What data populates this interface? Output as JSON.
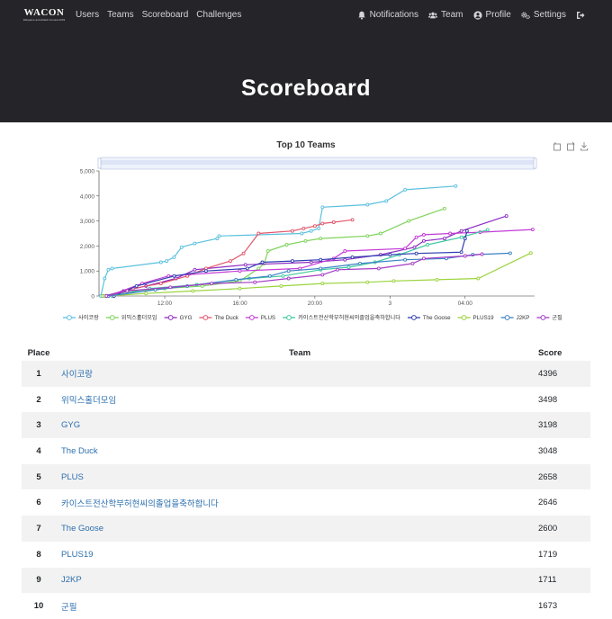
{
  "brand": {
    "name": "WACON",
    "tagline": "Wargame and Attack Contest 2023"
  },
  "nav": {
    "left": [
      "Users",
      "Teams",
      "Scoreboard",
      "Challenges"
    ],
    "right": [
      {
        "label": "Notifications",
        "icon": "bell-icon"
      },
      {
        "label": "Team",
        "icon": "users-icon"
      },
      {
        "label": "Profile",
        "icon": "user-circle-icon"
      },
      {
        "label": "Settings",
        "icon": "gears-icon"
      },
      {
        "label": "",
        "icon": "logout-icon"
      }
    ]
  },
  "page": {
    "title": "Scoreboard"
  },
  "toolbox_icons": [
    "zoom-icon",
    "zoom-reset-icon",
    "download-icon"
  ],
  "table": {
    "headers": {
      "place": "Place",
      "team": "Team",
      "score": "Score"
    },
    "rows": [
      {
        "place": "1",
        "team": "사이코랑",
        "score": "4396"
      },
      {
        "place": "2",
        "team": "위믹스홀더모임",
        "score": "3498"
      },
      {
        "place": "3",
        "team": "GYG",
        "score": "3198"
      },
      {
        "place": "4",
        "team": "The Duck",
        "score": "3048"
      },
      {
        "place": "5",
        "team": "PLUS",
        "score": "2658"
      },
      {
        "place": "6",
        "team": "카이스트전산학부허현씨의졸업을축하합니다",
        "score": "2646"
      },
      {
        "place": "7",
        "team": "The Goose",
        "score": "2600"
      },
      {
        "place": "8",
        "team": "PLUS19",
        "score": "1719"
      },
      {
        "place": "9",
        "team": "J2KP",
        "score": "1711"
      },
      {
        "place": "10",
        "team": "군필",
        "score": "1673"
      }
    ]
  },
  "chart_data": {
    "type": "line",
    "title": "Top 10 Teams",
    "xlabel": "",
    "ylabel": "",
    "x_ticks": [
      "12:00",
      "16:00",
      "20:00",
      "3",
      "04:00"
    ],
    "x_tick_hours": [
      12,
      16,
      20,
      24,
      28
    ],
    "x_range_hours": [
      8.5,
      31.7
    ],
    "y_ticks": [
      "0",
      "1,000",
      "2,000",
      "3,000",
      "4,000",
      "5,000"
    ],
    "ylim": [
      0,
      5000
    ],
    "grid": false,
    "legend_position": "bottom",
    "data_zoom_slider": true,
    "series": [
      {
        "name": "사이코랑",
        "color": "#5bc0de",
        "points": [
          [
            8.6,
            0
          ],
          [
            8.8,
            700
          ],
          [
            9.0,
            1050
          ],
          [
            9.2,
            1100
          ],
          [
            11.8,
            1350
          ],
          [
            12.1,
            1400
          ],
          [
            12.5,
            1550
          ],
          [
            12.9,
            1950
          ],
          [
            13.6,
            2100
          ],
          [
            14.8,
            2300
          ],
          [
            14.9,
            2400
          ],
          [
            19.3,
            2500
          ],
          [
            19.8,
            2600
          ],
          [
            20.2,
            2700
          ],
          [
            20.4,
            3550
          ],
          [
            22.8,
            3650
          ],
          [
            23.8,
            3800
          ],
          [
            24.8,
            4250
          ],
          [
            27.5,
            4396
          ]
        ]
      },
      {
        "name": "위믹스홀더모임",
        "color": "#7ed35a",
        "points": [
          [
            8.7,
            0
          ],
          [
            10.2,
            200
          ],
          [
            12.0,
            300
          ],
          [
            14.0,
            400
          ],
          [
            16.0,
            600
          ],
          [
            17.0,
            1100
          ],
          [
            17.3,
            1300
          ],
          [
            17.5,
            1800
          ],
          [
            18.5,
            2050
          ],
          [
            19.5,
            2200
          ],
          [
            20.3,
            2300
          ],
          [
            22.8,
            2400
          ],
          [
            23.5,
            2500
          ],
          [
            25.0,
            3000
          ],
          [
            26.9,
            3498
          ]
        ]
      },
      {
        "name": "GYG",
        "color": "#8e2cc4",
        "points": [
          [
            8.8,
            0
          ],
          [
            9.8,
            200
          ],
          [
            11.0,
            400
          ],
          [
            12.6,
            700
          ],
          [
            13.6,
            1050
          ],
          [
            16.3,
            1250
          ],
          [
            19.8,
            1350
          ],
          [
            21.6,
            1450
          ],
          [
            23.5,
            1650
          ],
          [
            25.3,
            1950
          ],
          [
            25.8,
            2200
          ],
          [
            26.9,
            2300
          ],
          [
            27.8,
            2600
          ],
          [
            30.2,
            3198
          ]
        ]
      },
      {
        "name": "The Duck",
        "color": "#e0556a",
        "points": [
          [
            8.9,
            0
          ],
          [
            10.3,
            300
          ],
          [
            11.8,
            500
          ],
          [
            13.2,
            800
          ],
          [
            14.2,
            1100
          ],
          [
            15.5,
            1400
          ],
          [
            16.2,
            1700
          ],
          [
            17.0,
            2500
          ],
          [
            18.8,
            2600
          ],
          [
            19.4,
            2700
          ],
          [
            20.0,
            2800
          ],
          [
            20.4,
            2900
          ],
          [
            21.0,
            2950
          ],
          [
            22.0,
            3048
          ]
        ]
      },
      {
        "name": "PLUS",
        "color": "#c33ad6",
        "points": [
          [
            9.0,
            0
          ],
          [
            10.8,
            500
          ],
          [
            12.2,
            800
          ],
          [
            16.0,
            1000
          ],
          [
            19.2,
            1100
          ],
          [
            21.0,
            1500
          ],
          [
            21.6,
            1800
          ],
          [
            24.8,
            1900
          ],
          [
            25.4,
            2350
          ],
          [
            25.8,
            2450
          ],
          [
            27.2,
            2500
          ],
          [
            28.8,
            2550
          ],
          [
            31.6,
            2658
          ]
        ]
      },
      {
        "name": "카이스트전산학부허현씨의졸업을축하합니다",
        "color": "#3ec9a0",
        "points": [
          [
            9.2,
            0
          ],
          [
            11.2,
            300
          ],
          [
            13.7,
            450
          ],
          [
            16.5,
            700
          ],
          [
            18.3,
            800
          ],
          [
            20.3,
            1050
          ],
          [
            21.8,
            1150
          ],
          [
            23.2,
            1350
          ],
          [
            24.5,
            1650
          ],
          [
            26.0,
            2050
          ],
          [
            27.8,
            2350
          ],
          [
            29.2,
            2646
          ]
        ]
      },
      {
        "name": "The Goose",
        "color": "#2f3fb0",
        "points": [
          [
            9.3,
            0
          ],
          [
            10.5,
            400
          ],
          [
            12.5,
            800
          ],
          [
            14.2,
            1000
          ],
          [
            16.4,
            1100
          ],
          [
            17.2,
            1350
          ],
          [
            18.8,
            1400
          ],
          [
            20.3,
            1450
          ],
          [
            22.0,
            1550
          ],
          [
            24.0,
            1650
          ],
          [
            25.4,
            1700
          ],
          [
            27.8,
            1750
          ],
          [
            28.0,
            2300
          ],
          [
            28.1,
            2600
          ]
        ]
      },
      {
        "name": "PLUS19",
        "color": "#9ad43c",
        "points": [
          [
            8.8,
            0
          ],
          [
            11.0,
            100
          ],
          [
            13.5,
            200
          ],
          [
            16.0,
            300
          ],
          [
            18.2,
            400
          ],
          [
            20.4,
            500
          ],
          [
            22.8,
            550
          ],
          [
            24.2,
            600
          ],
          [
            26.5,
            650
          ],
          [
            28.7,
            700
          ],
          [
            31.5,
            1719
          ]
        ]
      },
      {
        "name": "J2KP",
        "color": "#3b82c4",
        "points": [
          [
            9.0,
            0
          ],
          [
            11.5,
            250
          ],
          [
            13.2,
            400
          ],
          [
            15.8,
            650
          ],
          [
            17.6,
            800
          ],
          [
            18.6,
            1000
          ],
          [
            20.3,
            1100
          ],
          [
            22.4,
            1300
          ],
          [
            24.8,
            1450
          ],
          [
            27.0,
            1500
          ],
          [
            28.4,
            1650
          ],
          [
            30.4,
            1711
          ]
        ]
      },
      {
        "name": "군필",
        "color": "#a53ac7",
        "points": [
          [
            8.9,
            0
          ],
          [
            10.0,
            200
          ],
          [
            12.3,
            350
          ],
          [
            14.5,
            500
          ],
          [
            16.8,
            550
          ],
          [
            18.6,
            700
          ],
          [
            20.4,
            850
          ],
          [
            21.2,
            1050
          ],
          [
            23.4,
            1100
          ],
          [
            25.2,
            1300
          ],
          [
            25.8,
            1500
          ],
          [
            28.0,
            1600
          ],
          [
            28.9,
            1673
          ]
        ]
      }
    ]
  }
}
